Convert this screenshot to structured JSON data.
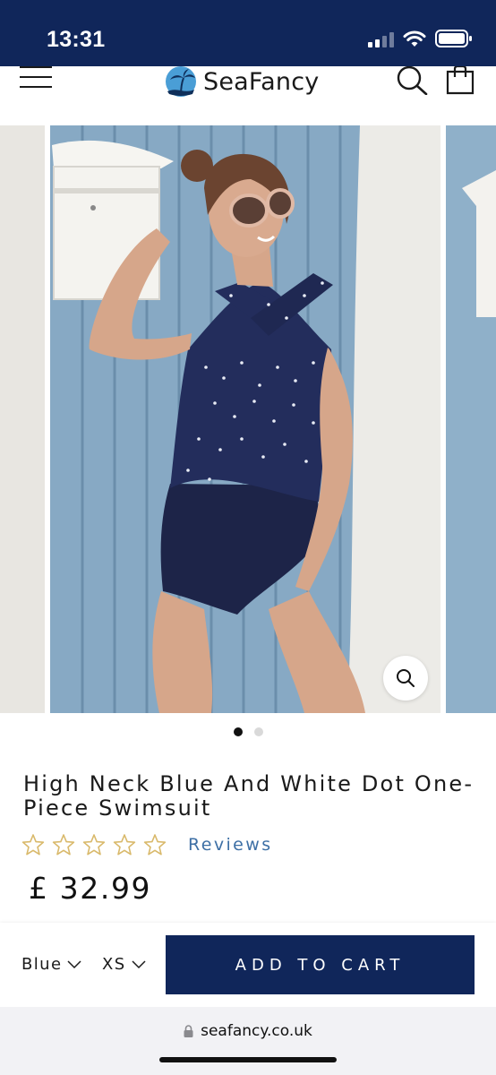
{
  "status_bar": {
    "time": "13:31",
    "icons": [
      "cellular-signal-icon",
      "wifi-icon",
      "battery-icon"
    ]
  },
  "header": {
    "menu_icon": "hamburger-menu-icon",
    "logo_text": "SeaFancy",
    "logo_icon": "palm-tree-logo-icon",
    "search_icon": "search-icon",
    "cart_icon": "shopping-bag-icon"
  },
  "gallery": {
    "zoom_icon": "magnifier-icon",
    "slide_count": 2,
    "active_slide": 1
  },
  "product": {
    "title": "High Neck Blue And White Dot One-Piece Swimsuit",
    "rating_stars": 0,
    "rating_max": 5,
    "reviews_label": "Reviews",
    "price": "£ 32.99"
  },
  "purchase_bar": {
    "color_value": "Blue",
    "size_value": "XS",
    "add_to_cart_label": "ADD TO CART"
  },
  "browser": {
    "url": "seafancy.co.uk"
  },
  "colors": {
    "brand_navy": "#10265a",
    "star_outline": "#d9b96b",
    "reviews_link": "#3d6fa5"
  }
}
